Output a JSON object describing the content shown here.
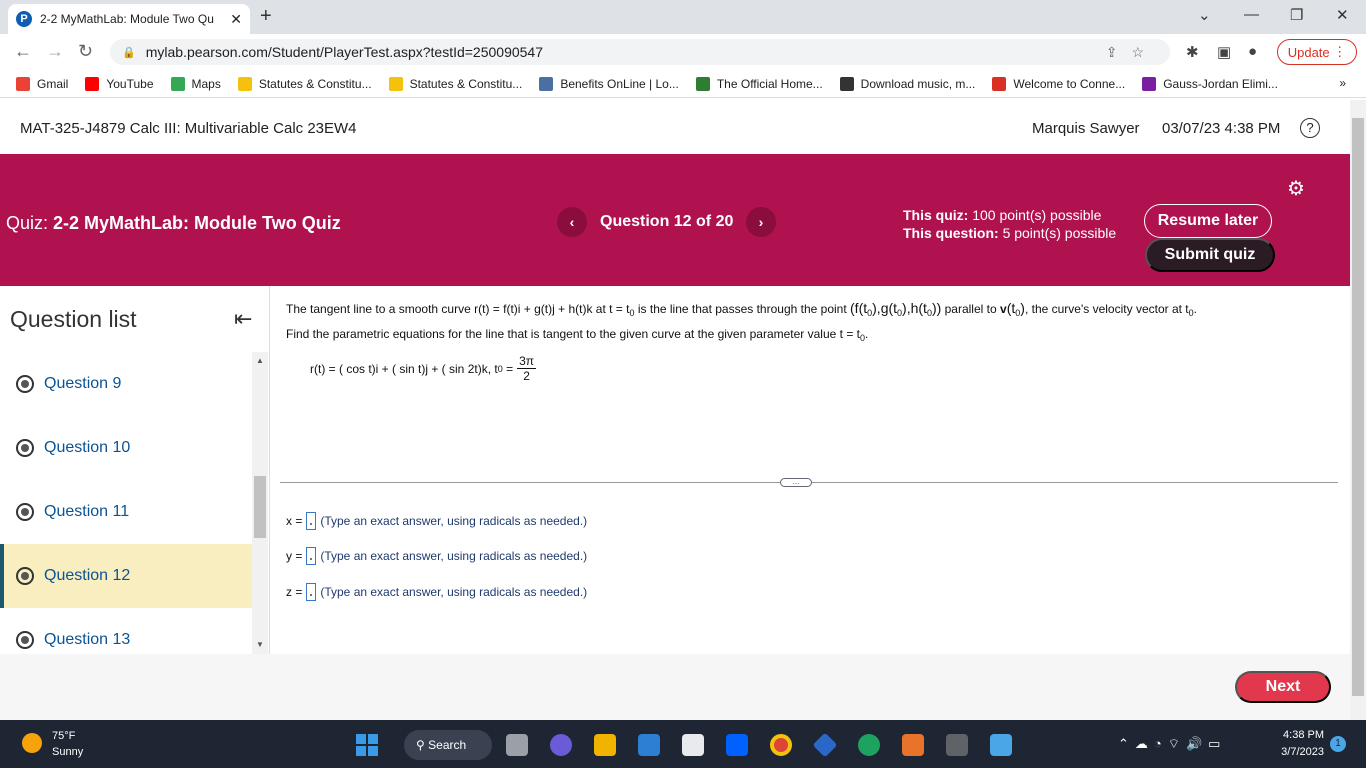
{
  "browser": {
    "tab_title": "2-2 MyMathLab: Module Two Qu",
    "url": "mylab.pearson.com/Student/PlayerTest.aspx?testId=250090547",
    "update_label": "Update",
    "bookmarks": [
      {
        "label": "Gmail",
        "color": "#ea4335"
      },
      {
        "label": "YouTube",
        "color": "#ff0000"
      },
      {
        "label": "Maps",
        "color": "#34a853"
      },
      {
        "label": "Statutes & Constitu...",
        "color": "#f4c20d"
      },
      {
        "label": "Statutes & Constitu...",
        "color": "#f4c20d"
      },
      {
        "label": "Benefits OnLine | Lo...",
        "color": "#4a6fa5"
      },
      {
        "label": "The Official Home...",
        "color": "#2e7d32"
      },
      {
        "label": "Download music, m...",
        "color": "#333333"
      },
      {
        "label": "Welcome to Conne...",
        "color": "#d93025"
      },
      {
        "label": "Gauss-Jordan Elimi...",
        "color": "#7b1fa2"
      }
    ],
    "bookmarks_more": "»"
  },
  "header": {
    "course_title": "MAT-325-J4879 Calc III: Multivariable Calc 23EW4",
    "user_name": "Marquis Sawyer",
    "datetime": "03/07/23 4:38 PM"
  },
  "quiz": {
    "label": "Quiz:",
    "name": "2-2 MyMathLab: Module Two Quiz",
    "question_counter": "Question 12 of 20",
    "this_quiz_label": "This quiz:",
    "this_quiz_value": "100 point(s) possible",
    "this_question_label": "This question:",
    "this_question_value": "5 point(s) possible",
    "resume_label": "Resume later",
    "submit_label": "Submit quiz",
    "accent_color": "#b0114f"
  },
  "question_list": {
    "title": "Question list",
    "items": [
      {
        "label": "Question 9"
      },
      {
        "label": "Question 10"
      },
      {
        "label": "Question 11"
      },
      {
        "label": "Question 12"
      },
      {
        "label": "Question 13"
      }
    ],
    "current_index": 3
  },
  "question": {
    "prompt_line1_a": "The tangent line to a smooth curve",
    "prompt_line1_b": "r(t) = f(t)i + g(t)j + h(t)k at t = t",
    "prompt_line1_c": "is the line that passes through the point",
    "prompt_point": "(f(t",
    "prompt_line1_d": "parallel to",
    "prompt_line1_e": ", the curve's velocity vector at t",
    "prompt_line2": "Find the parametric equations for the line that is tangent to the given curve at the given parameter value t = t",
    "formula_text": "r(t) = ( cos t)i + ( sin t)j + ( sin 2t)k, t",
    "formula_eq": "=",
    "fraction_num": "3π",
    "fraction_den": "2",
    "answers": [
      {
        "var": "x =",
        "hint": "(Type an exact answer, using radicals as needed.)"
      },
      {
        "var": "y =",
        "hint": "(Type an exact answer, using radicals as needed.)"
      },
      {
        "var": "z =",
        "hint": "(Type an exact answer, using radicals as needed.)"
      }
    ]
  },
  "footer": {
    "next_label": "Next"
  },
  "taskbar": {
    "temperature": "75°F",
    "condition": "Sunny",
    "search_label": "Search",
    "time": "4:38 PM",
    "date": "3/7/2023",
    "notification_count": "1"
  }
}
